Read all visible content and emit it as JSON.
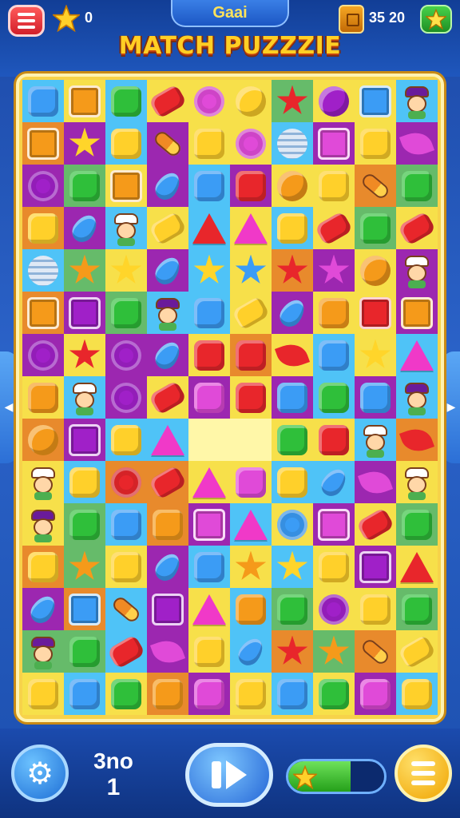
{
  "header": {
    "title_pill": "Gaai",
    "game_title": "MATCH PUZZZIE",
    "star_count": "0",
    "coin_count": "35 20"
  },
  "footer": {
    "moves_top": "3no",
    "moves_bottom": "1",
    "level_progress": 0.65
  },
  "icons": {
    "menu": "menu-icon",
    "star": "star-icon",
    "chest": "chest-icon",
    "bonus": "star-button-icon",
    "settings": "gear-icon",
    "play": "play-pause-icon",
    "list": "list-icon"
  },
  "colors": {
    "frame": "#f7d34a",
    "accent_blue": "#2566d6",
    "title_yellow": "#ffcf24"
  },
  "board": {
    "columns": 10,
    "rows": [
      [
        "b:sq-blue",
        "y:tile-orange",
        "b:sq-green",
        "y:bn-red",
        "y:sw-pink",
        "y:ci-yellow",
        "g:st-red",
        "y:ci-purple",
        "y:tile-blue",
        "b:fig-purple"
      ],
      [
        "o:tile-orange",
        "p:st-yellow",
        "b:sq-yellow",
        "p:rocket",
        "y:sq-yellow",
        "y:sw-pink",
        "b:coil",
        "p:tile-pink",
        "y:sq-yellow",
        "p:leaf-pink"
      ],
      [
        "p:sw-purple",
        "g:sq-green",
        "y:tile-orange",
        "p:dr-blue",
        "b:sq-blue",
        "p:sq-red",
        "y:ci-orange",
        "y:sq-yellow",
        "o:rocket",
        "g:sq-green"
      ],
      [
        "o:sq-yellow",
        "p:dr-blue",
        "b:fig-white",
        "y:bn-yellow",
        "b:tr-red",
        "y:tr-pink",
        "b:sq-yellow",
        "y:bn-red",
        "g:sq-green",
        "y:bn-red"
      ],
      [
        "b:coil",
        "g:st-orange",
        "y:st-yellow",
        "p:dr-blue",
        "b:st-yellow",
        "y:st-blue",
        "o:st-red",
        "p:st-pink",
        "y:ci-orange",
        "p:fig-white"
      ],
      [
        "o:tile-orange",
        "p:tile-purple",
        "g:sq-green",
        "b:fig-purple",
        "b:sq-blue",
        "y:bn-yellow",
        "p:dr-blue",
        "y:sq-orange",
        "y:tile-red",
        "p:tile-orange"
      ],
      [
        "p:sw-purple",
        "y:st-red",
        "p:sw-purple",
        "p:dr-blue",
        "y:sq-red",
        "o:sq-red",
        "y:leaf-red",
        "b:sq-blue",
        "y:st-yellow",
        "b:tr-pink"
      ],
      [
        "y:sq-orange",
        "b:fig-white",
        "p:sw-purple",
        "y:bn-red",
        "p:sq-pink",
        "y:sq-red",
        "p:sq-blue",
        "b:sq-green",
        "p:sq-blue",
        "b:fig-purple"
      ],
      [
        "o:ci-orange",
        "p:tile-purple",
        "b:sq-yellow",
        "b:tr-pink",
        "e:empty",
        "e:empty",
        "y:sq-green",
        "y:sq-red",
        "b:fig-white",
        "o:leaf-red"
      ],
      [
        "y:fig-white",
        "b:sq-yellow",
        "o:sw-red",
        "o:bn-red",
        "y:tr-pink",
        "y:sq-pink",
        "b:sq-yellow",
        "b:dr-blue",
        "p:leaf-pink",
        "y:fig-white"
      ],
      [
        "y:fig-purple",
        "g:sq-green",
        "b:sq-blue",
        "o:sq-orange",
        "p:tile-pink",
        "b:tr-pink",
        "y:sw-blue",
        "p:tile-pink",
        "y:bn-red",
        "g:sq-green"
      ],
      [
        "o:sq-yellow",
        "g:st-orange",
        "y:sq-yellow",
        "p:dr-blue",
        "b:sq-blue",
        "y:st-orange",
        "b:st-yellow",
        "y:sq-yellow",
        "p:tile-purple",
        "y:tr-red"
      ],
      [
        "p:dr-blue",
        "o:tile-blue",
        "b:rocket",
        "p:tile-purple",
        "y:tr-pink",
        "b:sq-orange",
        "g:sq-green",
        "y:sw-purple",
        "y:sq-yellow",
        "g:sq-green"
      ],
      [
        "g:fig-purple",
        "g:sq-green",
        "b:bn-red",
        "p:leaf-pink",
        "y:sq-yellow",
        "b:dr-blue",
        "o:st-red",
        "g:st-orange",
        "o:rocket",
        "y:bn-yellow"
      ],
      [
        "y:sq-yellow",
        "b:sq-blue",
        "y:sq-green",
        "o:sq-orange",
        "p:sq-pink",
        "y:sq-yellow",
        "b:sq-blue",
        "y:sq-green",
        "p:sq-pink",
        "b:sq-yellow"
      ]
    ]
  }
}
